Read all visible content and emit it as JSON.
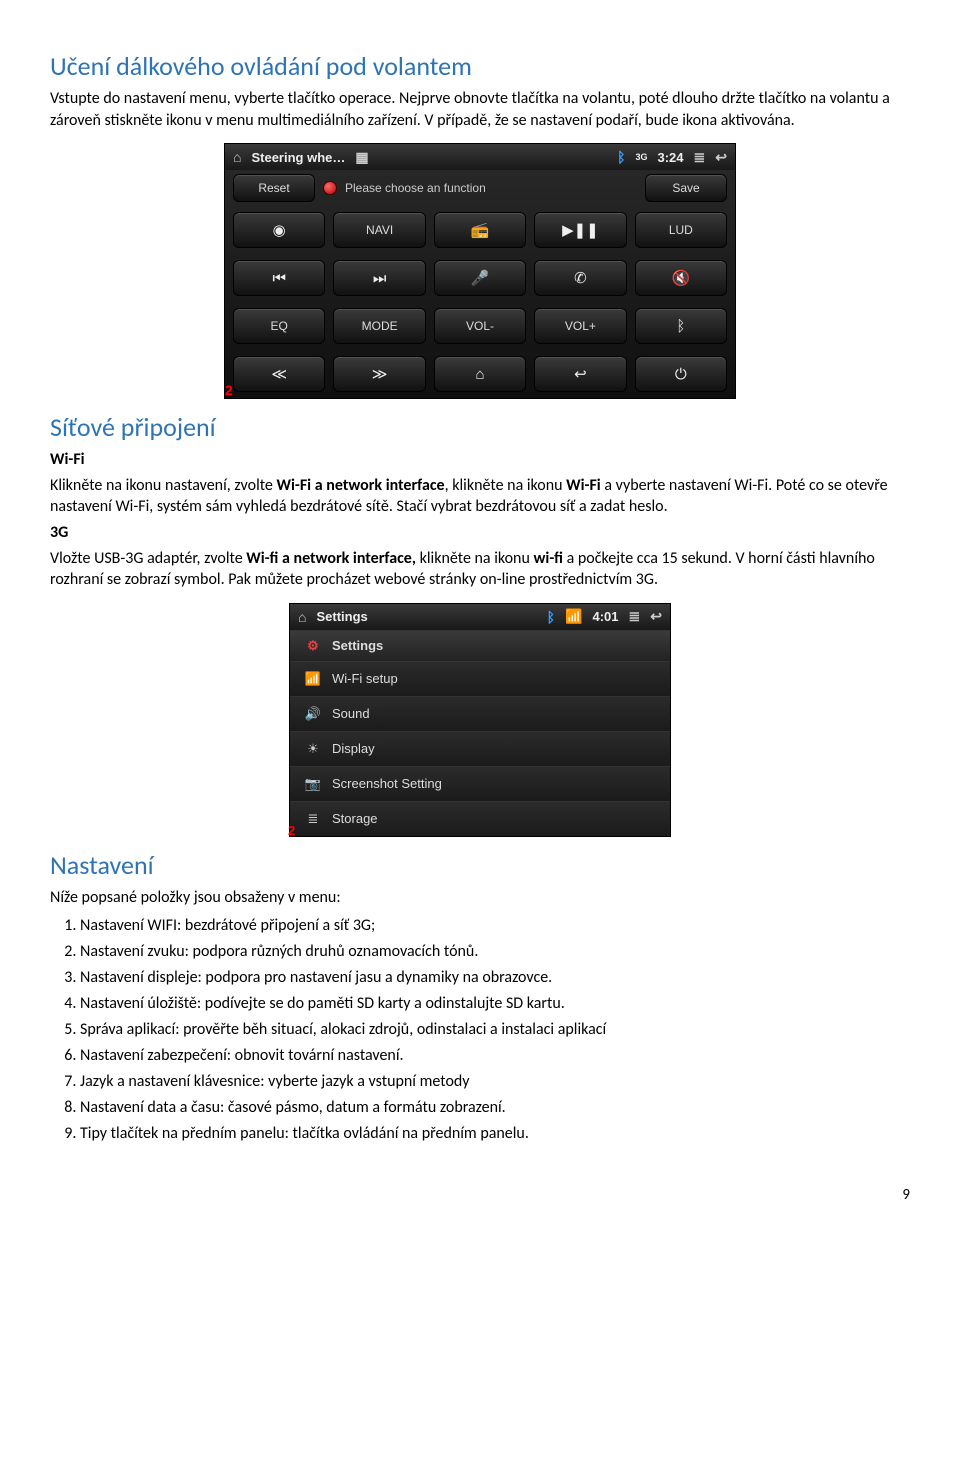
{
  "section1": {
    "title": "Učení dálkového ovládání pod volantem",
    "para": "Vstupte do nastavení menu, vyberte tlačítko operace. Nejprve obnovte tlačítka na volantu, poté dlouho držte tlačítko na volantu a zároveň stiskněte ikonu v menu multimediálního zařízení. V případě, že se nastavení podaří, bude ikona aktivována."
  },
  "device1": {
    "status": {
      "title": "Steering whe…",
      "time": "3:24",
      "bt": "3G"
    },
    "reset": "Reset",
    "save": "Save",
    "instruction": "Please choose an function",
    "row2": [
      "",
      "NAVI",
      "",
      "",
      "LUD"
    ],
    "row3_labels": [
      "",
      "",
      "",
      "",
      ""
    ],
    "row4": [
      "EQ",
      "MODE",
      "VOL-",
      "VOL+",
      ""
    ],
    "pagebadge": "2"
  },
  "section2": {
    "title": "Síťové připojení",
    "wifi_h": "Wi-Fi",
    "wifi_p": "Klikněte na ikonu nastavení, zvolte Wi-Fi a network interface, klikněte na ikonu Wi-Fi a vyberte nastavení Wi-Fi. Poté co se otevře nastavení Wi-Fi, systém sám vyhledá bezdrátové sítě. Stačí vybrat bezdrátovou síť a zadat heslo.",
    "g3_h": "3G",
    "g3_p1": "Vložte USB-3G adaptér, zvolte Wi-fi a network interface, klikněte na ikonu wi-fi a počkejte cca 15 sekund. V horní části hlavního rozhraní se zobrazí symbol. Pak můžete procházet webové stránky on-line prostřednictvím 3G."
  },
  "device2": {
    "status": {
      "title": "Settings",
      "time": "4:01"
    },
    "head": "Settings",
    "items": [
      {
        "icon": "📶",
        "label": "Wi-Fi setup"
      },
      {
        "icon": "🔊",
        "label": "Sound"
      },
      {
        "icon": "☀",
        "label": "Display"
      },
      {
        "icon": "📷",
        "label": "Screenshot Setting"
      },
      {
        "icon": "≣",
        "label": "Storage"
      }
    ],
    "pagebadge": "2"
  },
  "section3": {
    "title": "Nastavení",
    "intro": "Níže popsané položky jsou obsaženy v menu:",
    "list": [
      "Nastavení WIFI: bezdrátové připojení a síť 3G;",
      "Nastavení zvuku: podpora různých druhů oznamovacích tónů.",
      "Nastavení displeje: podpora pro nastavení jasu a dynamiky na obrazovce.",
      "Nastavení úložiště: podívejte se do paměti SD karty a odinstalujte SD kartu.",
      "Správa aplikací: prověřte běh situací, alokaci zdrojů, odinstalaci a instalaci aplikací",
      "Nastavení zabezpečení: obnovit tovární nastavení.",
      "Jazyk a nastavení klávesnice: vyberte jazyk a vstupní metody",
      "Nastavení data a času: časové pásmo, datum a formátu zobrazení.",
      "Tipy tlačítek na předním panelu: tlačítka ovládání na předním panelu."
    ]
  },
  "pagenum": "9"
}
